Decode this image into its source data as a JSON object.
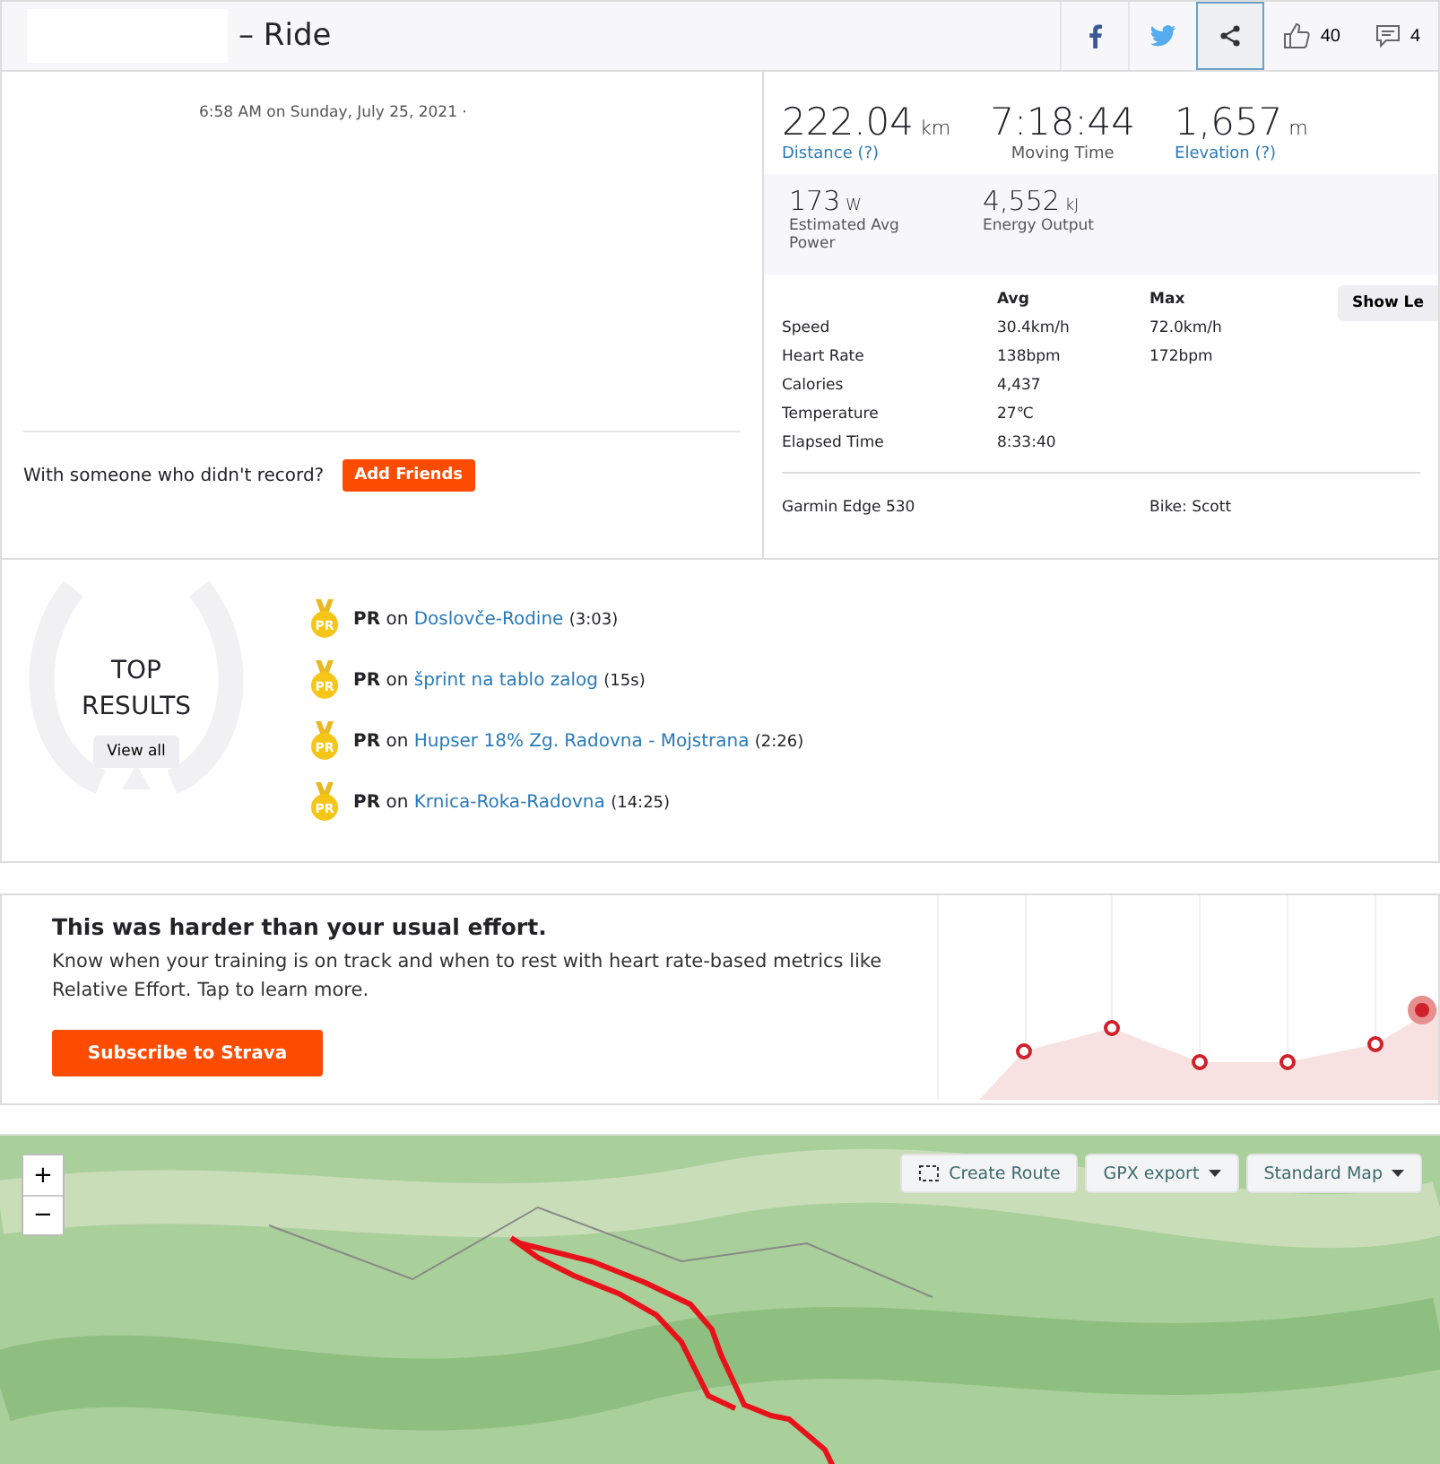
{
  "header": {
    "title": "– Ride",
    "likes": "40",
    "comments": "4",
    "share_selected": true
  },
  "activity": {
    "date": "6:58 AM on Sunday, July 25, 2021 ·",
    "friend_prompt": "With someone who didn't record?",
    "add_button": "Add Friends"
  },
  "primary_stats": [
    {
      "value": "222.04",
      "unit": "km",
      "label": "Distance (?)",
      "kind": "link"
    },
    {
      "value": "7:18:44",
      "label": "Moving Time",
      "kind": "plain"
    },
    {
      "value": "1,657",
      "unit": "m",
      "label": "Elevation (?)",
      "kind": "link"
    }
  ],
  "secondary_stats": [
    {
      "value": "173",
      "unit": "W",
      "label": "Estimated Avg Power"
    },
    {
      "value": "4,552",
      "unit": "kJ",
      "label": "Energy Output"
    }
  ],
  "details": {
    "columns": [
      "Avg",
      "Max"
    ],
    "show_button": "Show Le",
    "rows": [
      {
        "label": "Speed",
        "avg": "30.4km/h",
        "max": "72.0km/h"
      },
      {
        "label": "Heart Rate",
        "avg": "138bpm",
        "max": "172bpm"
      },
      {
        "label": "Calories",
        "avg": "4,437"
      },
      {
        "label": "Temperature",
        "avg": "27℃"
      },
      {
        "label": "Elapsed Time",
        "avg": "8:33:40"
      }
    ],
    "device": "Garmin Edge 530",
    "bike": "Bike: Scott"
  },
  "top_results": {
    "title": "TOP RESULTS",
    "view_all": "View all",
    "items": [
      {
        "badge": "PR",
        "prefix": "**PR** on",
        "segment": "Doslovče-Rodine",
        "time": "(3:03)"
      },
      {
        "badge": "PR",
        "prefix": "**PR** on",
        "segment": "šprint na tablo zalog",
        "time": "(15s)"
      },
      {
        "badge": "PR",
        "prefix": "**PR** on",
        "segment": "Hupser 18% Zg. Radovna - Mojstrana",
        "time": "(2:26)"
      },
      {
        "badge": "PR",
        "prefix": "**PR** on",
        "segment": "Krnica-Roka-Radovna",
        "time": "(14:25)"
      }
    ]
  },
  "effort": {
    "title": "This was harder than your usual effort.",
    "text": "Know when your training is on track and when to rest with heart rate-based metrics like Relative Effort. Tap to learn more.",
    "button": "Subscribe to Strava"
  },
  "map": {
    "zoom_in": "+",
    "zoom_out": "−",
    "buttons": [
      {
        "label": "Create Route",
        "kind": "create"
      },
      {
        "label": "GPX export",
        "kind": "dropdown"
      },
      {
        "label": "Standard Map",
        "kind": "dropdown"
      }
    ]
  }
}
